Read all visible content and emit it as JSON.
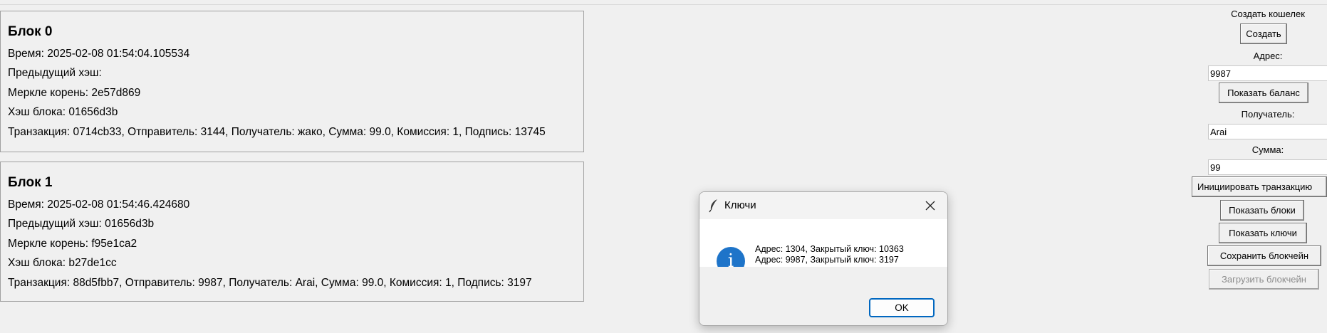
{
  "blocks": [
    {
      "title": "Блок 0",
      "time": "Время: 2025-02-08 01:54:04.105534",
      "prev_hash": "Предыдущий хэш:",
      "merkle_root": "Меркле корень: 2e57d869",
      "block_hash": "Хэш блока: 01656d3b",
      "transaction": "Транзакция: 0714cb33, Отправитель: 3144, Получатель: жако, Сумма: 99.0, Комиссия: 1, Подпись: 13745"
    },
    {
      "title": "Блок 1",
      "time": "Время: 2025-02-08 01:54:46.424680",
      "prev_hash": "Предыдущий хэш: 01656d3b",
      "merkle_root": "Меркле корень: f95e1ca2",
      "block_hash": "Хэш блока: b27de1cc",
      "transaction": "Транзакция: 88d5fbb7, Отправитель: 9987, Получатель: Arai, Сумма: 99.0, Комиссия: 1, Подпись: 3197"
    }
  ],
  "sidebar": {
    "create_wallet_label": "Создать кошелек",
    "create_button": "Создать",
    "address_label": "Адрес:",
    "address_value": "9987",
    "show_balance_button": "Показать баланс",
    "recipient_label": "Получатель:",
    "recipient_value": "Arai",
    "amount_label": "Сумма:",
    "amount_value": "99",
    "initiate_tx_button": "Инициировать транзакцию",
    "show_blocks_button": "Показать блоки",
    "show_keys_button": "Показать ключи",
    "save_chain_button": "Сохранить блокчейн",
    "load_chain_button": "Загрузить блокчейн"
  },
  "dialog": {
    "title": "Ключи",
    "title_icon": "feather-icon",
    "info_icon": "info-icon",
    "lines": [
      "Адрес: 1304, Закрытый ключ: 10363",
      "Адрес: 9987, Закрытый ключ: 3197"
    ],
    "ok_button": "OK"
  },
  "colors": {
    "window_bg": "#f0f0f0",
    "info_blue": "#1e74c9",
    "focus_blue": "#0067c0"
  }
}
